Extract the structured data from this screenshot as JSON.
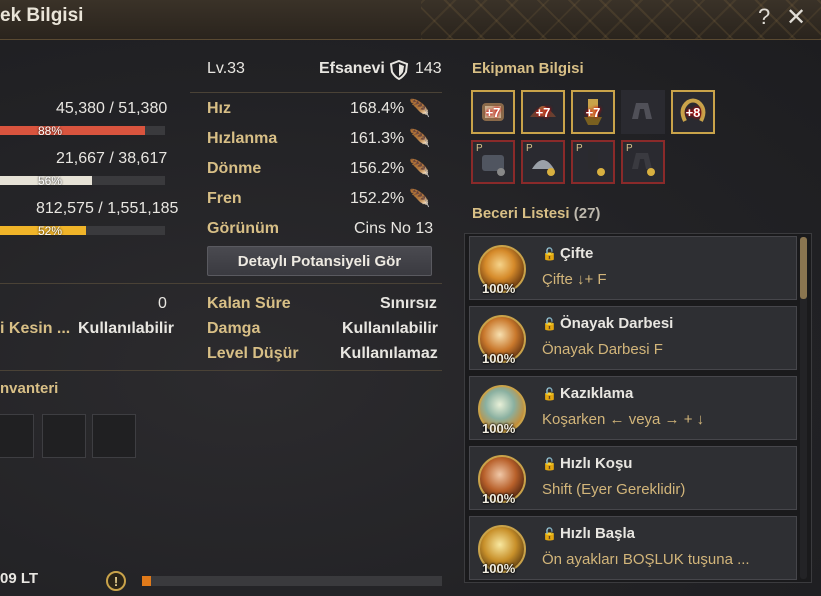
{
  "window": {
    "title": "ek Bilgisi",
    "help_icon": "question-icon",
    "close_icon": "close-icon"
  },
  "stats": {
    "hp": {
      "current": "45,380",
      "max": "51,380",
      "percent_text": "88%",
      "fraction": 0.88,
      "color": "#d9543e"
    },
    "stamina": {
      "current": "21,667",
      "max": "38,617",
      "percent_text": "56%",
      "fraction": 0.56,
      "color": "#e6e2d6"
    },
    "exp": {
      "current": "812,575",
      "max": "1,551,185",
      "percent_text": "52%",
      "fraction": 0.52,
      "color": "#f0b429"
    },
    "separator": "/"
  },
  "info": {
    "level": "Lv.33",
    "grade": "Efsanevi",
    "armor_value": "143",
    "attributes": [
      {
        "label": "Hız",
        "value": "168.4%"
      },
      {
        "label": "Hızlanma",
        "value": "161.3%"
      },
      {
        "label": "Dönme",
        "value": "156.2%"
      },
      {
        "label": "Fren",
        "value": "152.2%"
      }
    ],
    "appearance_label": "Görünüm",
    "appearance_value": "Cins No 13",
    "potential_button": "Detaylı Potansiyeli Gör"
  },
  "left_lower": {
    "count_value": "0",
    "kesin_label": "i Kesin ...",
    "kesin_value": "Kullanılabilir"
  },
  "status": [
    {
      "label": "Kalan Süre",
      "value": "Sınırsız"
    },
    {
      "label": "Damga",
      "value": "Kullanılabilir"
    },
    {
      "label": "Level Düşür",
      "value": "Kullanılamaz"
    }
  ],
  "inventory": {
    "title": "nvanteri",
    "capacity": "09 LT",
    "warning_icon": "exclamation-icon",
    "capacity_fraction": 0.03
  },
  "equipment": {
    "title": "Ekipman Bilgisi",
    "row1": [
      {
        "icon": "horse-armor-icon",
        "enhance": "+7",
        "border": "gold"
      },
      {
        "icon": "saddle-icon",
        "enhance": "+7",
        "border": "gold"
      },
      {
        "icon": "stirrups-icon",
        "enhance": "+7",
        "border": "gold"
      },
      {
        "icon": "horseshoe-empty-icon",
        "enhance": "",
        "border": "none"
      },
      {
        "icon": "horseshoe-icon",
        "enhance": "+8",
        "border": "gold"
      }
    ],
    "row2": [
      {
        "icon": "costume-armor-icon",
        "tag": "P",
        "border": "red"
      },
      {
        "icon": "costume-saddle-icon",
        "tag": "P",
        "border": "red"
      },
      {
        "icon": "costume-stirrups-icon",
        "tag": "P",
        "border": "red"
      },
      {
        "icon": "costume-horseshoe-icon",
        "tag": "P",
        "border": "red"
      }
    ]
  },
  "skills": {
    "title": "Beceri Listesi",
    "count": "(27)",
    "items": [
      {
        "name": "Çifte",
        "desc": "Çifte ↓+ F",
        "percent": "100%"
      },
      {
        "name": "Önayak Darbesi",
        "desc": "Önayak Darbesi F",
        "percent": "100%"
      },
      {
        "name": "Kazıklama",
        "desc": "Koşarken ← veya → + ↓",
        "percent": "100%"
      },
      {
        "name": "Hızlı Koşu",
        "desc": "Shift (Eyer Gereklidir)",
        "percent": "100%"
      },
      {
        "name": "Hızlı Başla",
        "desc": "Ön ayakları BOŞLUK tuşuna ...",
        "percent": "100%"
      }
    ]
  }
}
